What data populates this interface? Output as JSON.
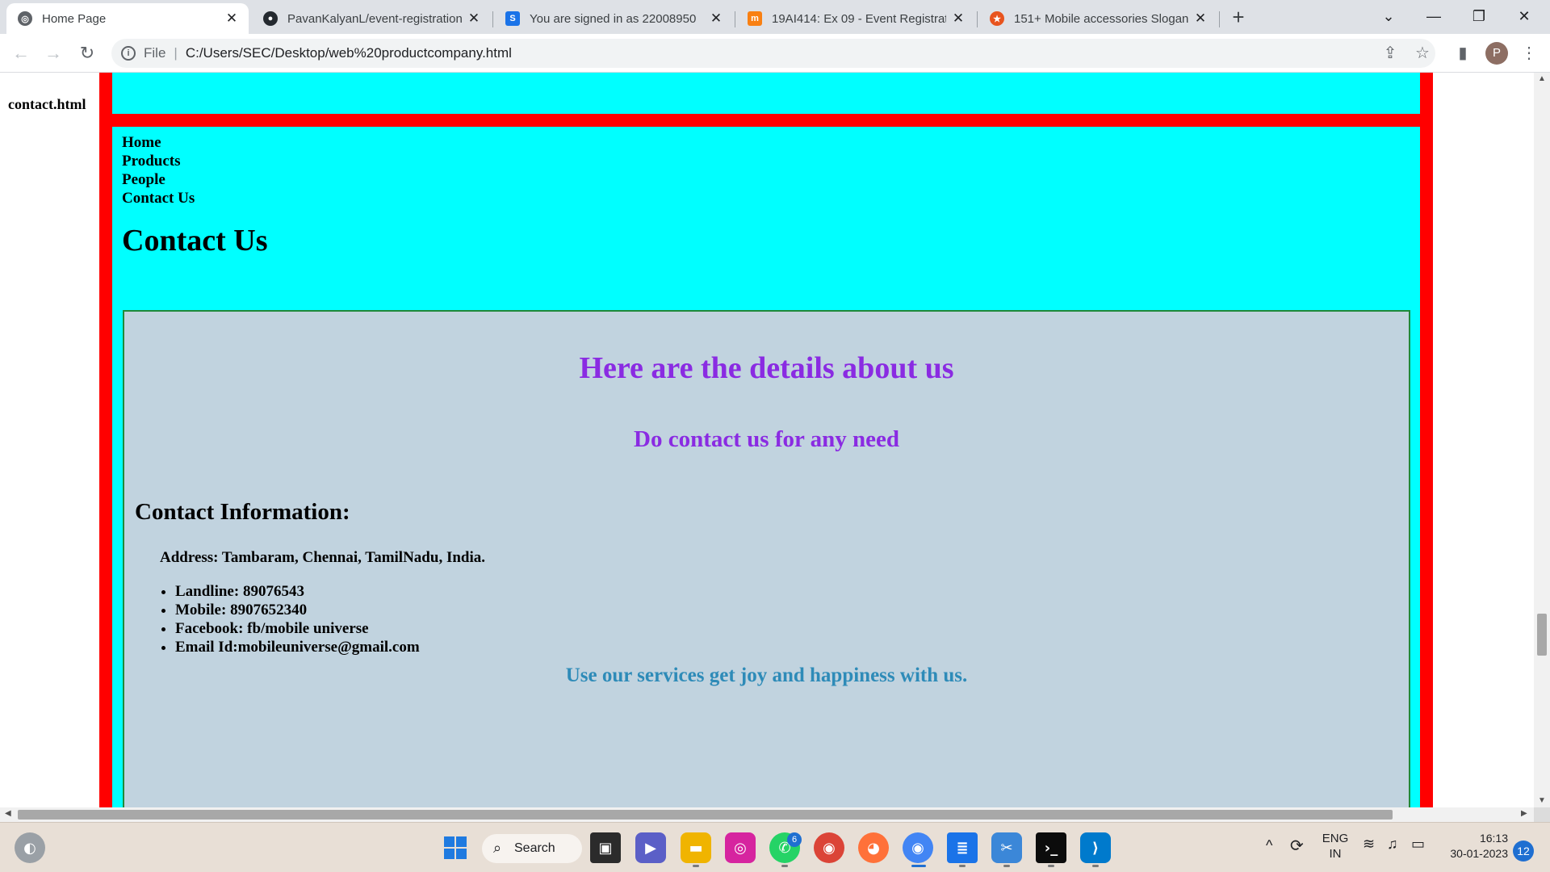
{
  "browser": {
    "tabs": [
      {
        "title": "Home Page",
        "favicon": "globe-icon"
      },
      {
        "title": "PavanKalyanL/event-registration",
        "favicon": "github-icon"
      },
      {
        "title": "You are signed in as 22008950",
        "favicon": "s-logo-icon"
      },
      {
        "title": "19AI414: Ex 09 - Event Registratic",
        "favicon": "moodle-icon"
      },
      {
        "title": "151+ Mobile accessories Slogans",
        "favicon": "star-badge-icon"
      }
    ],
    "new_tab": "+",
    "address_scheme": "File",
    "address_url": "C:/Users/SEC/Desktop/web%20productcompany.html",
    "profile_initial": "P"
  },
  "page": {
    "file_label": "contact.html",
    "nav": [
      "Home",
      "Products",
      "People",
      "Contact Us"
    ],
    "heading": "Contact Us",
    "details_heading": "Here are the details about us",
    "sub_heading": "Do contact us for any need",
    "contact_heading": "Contact Information:",
    "address": "Address: Tambaram, Chennai, TamilNadu, India.",
    "contacts": [
      "Landline: 89076543",
      "Mobile: 8907652340",
      "Facebook: fb/mobile universe",
      "Email Id:mobileuniverse@gmail.com"
    ],
    "tagline": "Use our services get joy and happiness with us."
  },
  "colors": {
    "outer_border": "#ff0000",
    "content_bg": "#00ffff",
    "panel_bg": "#c1d3df",
    "panel_border": "#1f8a3a",
    "purple_heading": "#8a2be2",
    "tagline": "#2e8bb8"
  },
  "taskbar": {
    "search_label": "Search",
    "whatsapp_badge": "6",
    "language": "ENG",
    "region": "IN",
    "time": "16:13",
    "date": "30-01-2023",
    "notifications": "12"
  }
}
